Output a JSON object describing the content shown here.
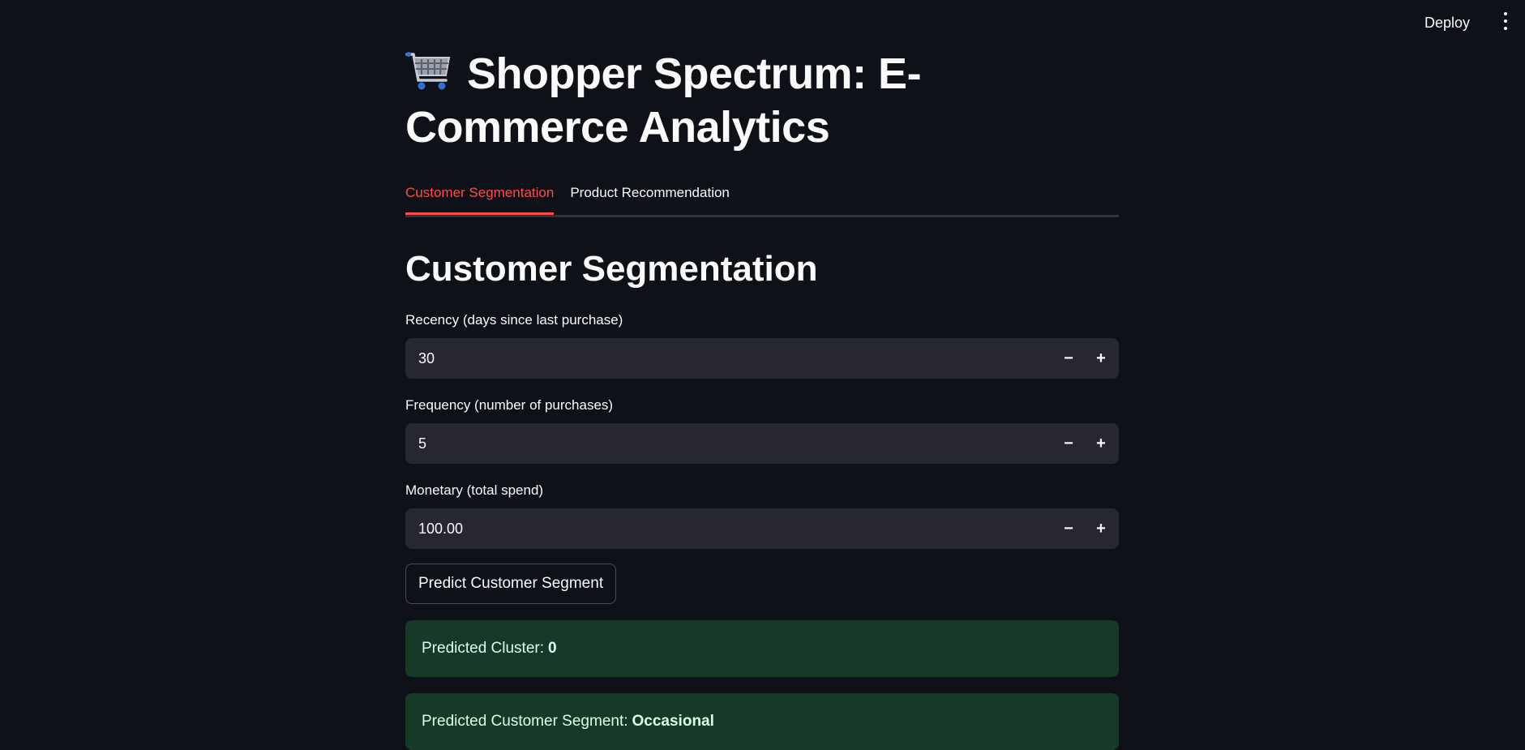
{
  "header": {
    "deploy_label": "Deploy",
    "menu_icon": "vertical-ellipsis-icon"
  },
  "app": {
    "title_icon": "shopping-cart-icon",
    "title": "Shopper Spectrum: E-Commerce Analytics"
  },
  "tabs": [
    {
      "label": "Customer Segmentation",
      "active": true
    },
    {
      "label": "Product Recommendation",
      "active": false
    }
  ],
  "section": {
    "title": "Customer Segmentation"
  },
  "fields": {
    "recency": {
      "label": "Recency (days since last purchase)",
      "value": "30"
    },
    "frequency": {
      "label": "Frequency (number of purchases)",
      "value": "5"
    },
    "monetary": {
      "label": "Monetary (total spend)",
      "value": "100.00"
    }
  },
  "stepper": {
    "minus": "−",
    "plus": "+"
  },
  "predict_button": "Predict Customer Segment",
  "results": {
    "cluster_label": "Predicted Cluster:",
    "cluster_value": "0",
    "segment_label": "Predicted Customer Segment:",
    "segment_value": "Occasional"
  },
  "colors": {
    "background": "#0e1117",
    "accent": "#ff4b4b",
    "input_bg": "#262730",
    "success_bg": "#173928"
  }
}
